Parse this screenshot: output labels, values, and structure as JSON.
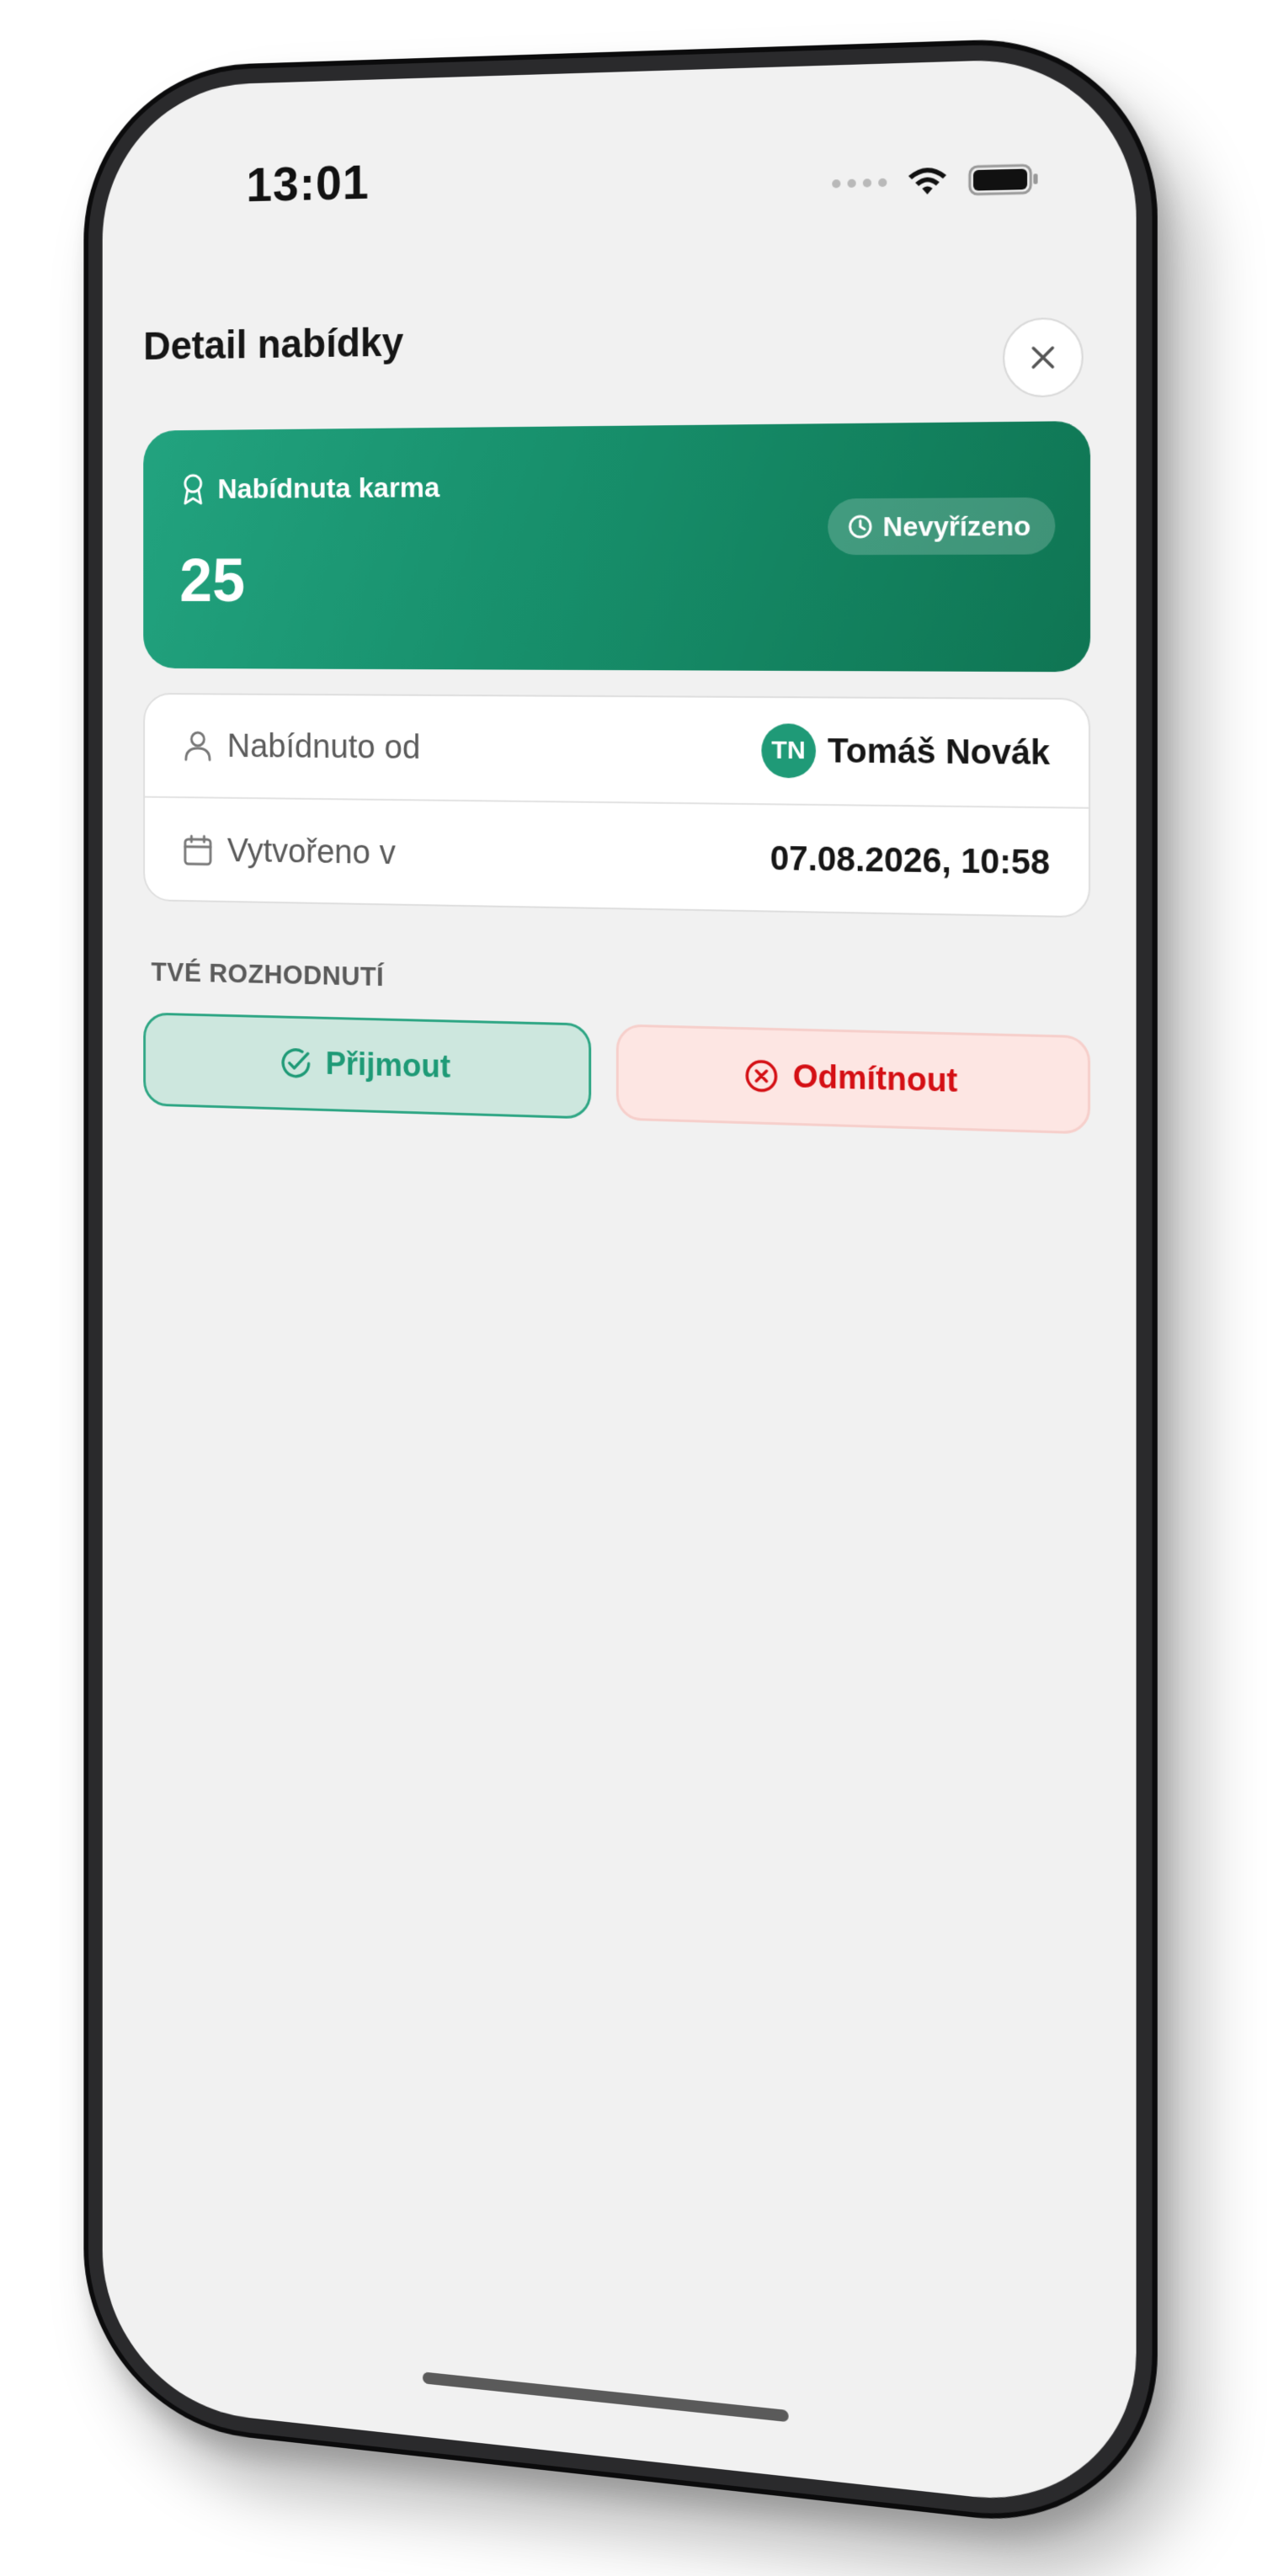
{
  "status_bar": {
    "time": "13:01",
    "signal_icon": "signal-dots-icon",
    "wifi_icon": "wifi-icon",
    "battery_icon": "battery-icon"
  },
  "header": {
    "title": "Detail nabídky",
    "close_icon": "close-icon"
  },
  "karma_card": {
    "label": "Nabídnuta karma",
    "label_icon": "award-icon",
    "value": "25",
    "status_label": "Nevyřízeno",
    "status_icon": "clock-icon",
    "gradient_colors": [
      "#22a37f",
      "#0f7553"
    ]
  },
  "info": {
    "offered_by_label": "Nabídnuto od",
    "offered_by_icon": "user-icon",
    "offered_by_initials": "TN",
    "offered_by_name": "Tomáš Novák",
    "created_label": "Vytvořeno v",
    "created_icon": "calendar-icon",
    "created_value": "07.08.2026, 10:58"
  },
  "decision": {
    "heading": "TVÉ ROZHODNUTÍ",
    "accept_label": "Přijmout",
    "accept_icon": "check-circle-icon",
    "accept_color": "#1e9a76",
    "decline_label": "Odmítnout",
    "decline_icon": "x-circle-icon",
    "decline_color": "#d40f14"
  }
}
